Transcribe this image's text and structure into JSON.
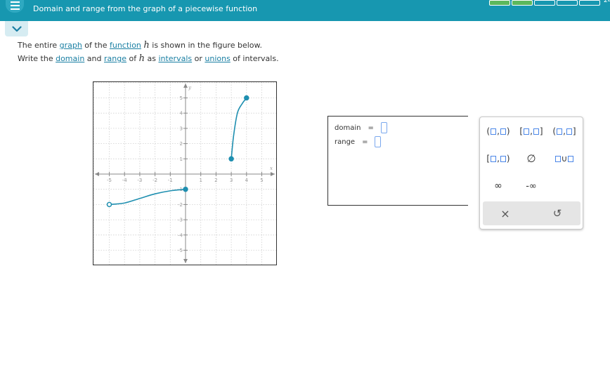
{
  "header": {
    "title": "Domain and range from the graph of a piecewise function",
    "progress_segments": [
      true,
      true,
      false,
      false,
      false
    ],
    "progress_count": "24",
    "accent_color": "#1797b0",
    "progress_fill_color": "#5cb85c"
  },
  "prompt": {
    "line1": {
      "t1": "The entire ",
      "graph_link": "graph",
      "t2": " of the ",
      "function_link": "function",
      "t3": " ",
      "var": "h",
      "t4": " is shown in the figure below."
    },
    "line2": {
      "t1": "Write the ",
      "domain_link": "domain",
      "t2": " and ",
      "range_link": "range",
      "t3": " of ",
      "var": "h",
      "t4": " as ",
      "intervals_link": "intervals",
      "t5": " or ",
      "unions_link": "unions",
      "t6": " of intervals."
    }
  },
  "graph": {
    "x_axis_label": "x",
    "y_axis_label": "y",
    "x_ticks": [
      "-5",
      "-4",
      "-3",
      "-2",
      "-1",
      "1",
      "2",
      "3",
      "4",
      "5"
    ],
    "y_ticks": [
      "5",
      "4",
      "3",
      "2",
      "1",
      "-1",
      "-2",
      "-3",
      "-4",
      "-5"
    ],
    "curve_color": "#1f8fb0",
    "pieces": [
      {
        "points": [
          [
            -5,
            -2
          ],
          [
            -4,
            -1.9
          ],
          [
            -3,
            -1.6
          ],
          [
            -2,
            -1.3
          ],
          [
            -1,
            -1.1
          ],
          [
            0,
            -1
          ]
        ],
        "start": {
          "x": -5,
          "y": -2,
          "closed": false
        },
        "end": {
          "x": 0,
          "y": -1,
          "closed": true
        }
      },
      {
        "points": [
          [
            3,
            1
          ],
          [
            3.15,
            2.5
          ],
          [
            3.4,
            4
          ],
          [
            3.7,
            4.6
          ],
          [
            4,
            5
          ]
        ],
        "start": {
          "x": 3,
          "y": 1,
          "closed": true
        },
        "end": {
          "x": 4,
          "y": 5,
          "closed": true
        }
      }
    ]
  },
  "answer": {
    "domain_label": "domain",
    "range_label": "range",
    "equals": "="
  },
  "keypad": {
    "infinity": "∞",
    "neg_infinity": "-∞",
    "empty_set": "∅",
    "union_symbol": "∪",
    "clear_icon": "×",
    "undo_icon": "↺"
  }
}
